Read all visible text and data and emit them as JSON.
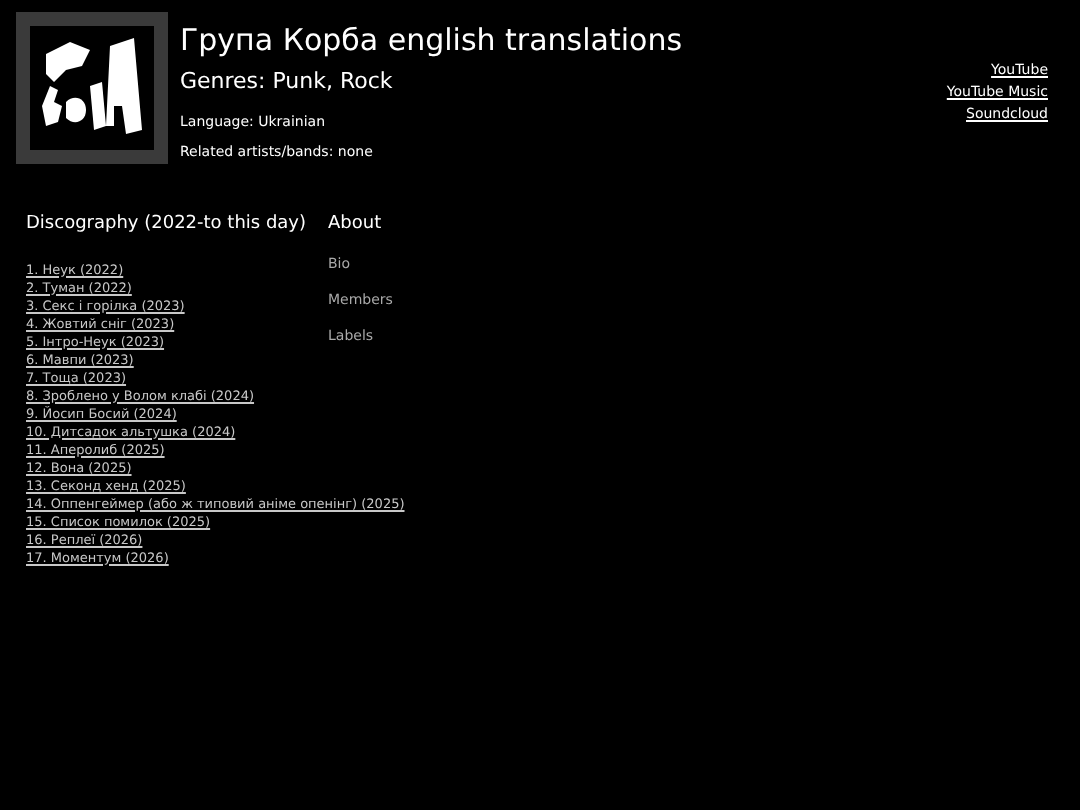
{
  "header": {
    "title": "Група Корба english translations",
    "genres": "Genres: Punk, Rock",
    "language": "Language: Ukrainian",
    "related": "Related artists/bands: none"
  },
  "links": [
    "YouTube",
    "YouTube Music",
    "Soundcloud"
  ],
  "discography": {
    "heading": "Discography (2022-to this day)",
    "items": [
      "1. Неук (2022)",
      "2. Туман (2022)",
      "3. Секс і горілка (2023)",
      "4. Жовтий сніг (2023)",
      "5. Інтро-Неук (2023)",
      "6. Мавпи (2023)",
      "7. Тоща (2023)",
      "8. Зроблено у Волом клабі (2024)",
      "9. Йосип Босий (2024)",
      "10. Дитсадок альтушка (2024)",
      "11. Аперолиб (2025)",
      "12. Вона (2025)",
      "13. Секонд хенд (2025)",
      "14. Оппенгеймер (або ж типовий аніме опенінг) (2025)",
      "15. Список помилок (2025)",
      "16. Реплеї (2026)",
      "17. Моментум (2026)"
    ]
  },
  "about": {
    "heading": "About",
    "items": [
      "Bio",
      "Members",
      "Labels"
    ]
  }
}
